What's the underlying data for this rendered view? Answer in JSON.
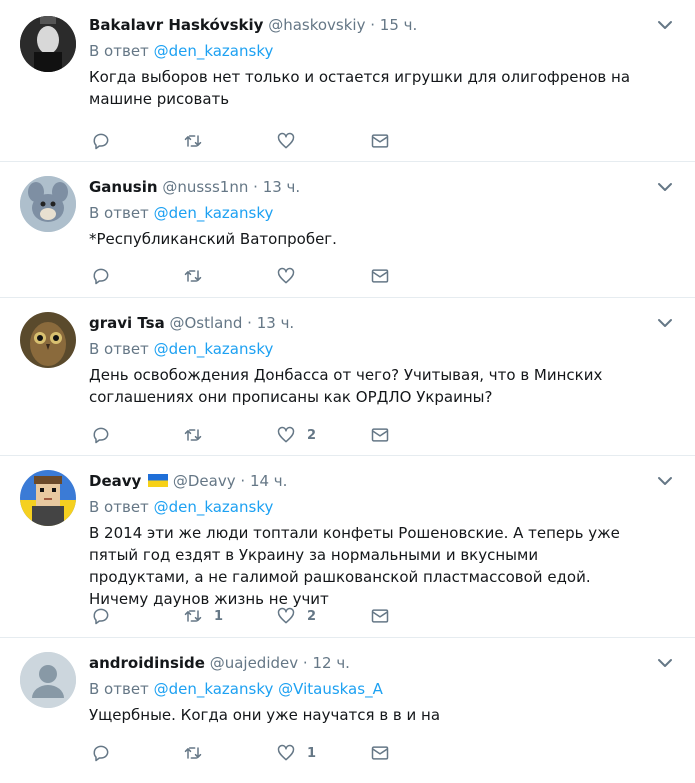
{
  "replying_prefix": "В ответ",
  "colors": {
    "link": "#1da1f2",
    "secondary": "#657786",
    "text": "#14171a",
    "border": "#e6ecf0"
  },
  "icons": {
    "reply": "reply-icon",
    "retweet": "retweet-icon",
    "like": "like-icon",
    "dm": "dm-icon",
    "caret": "chevron-down-icon"
  },
  "tweets": [
    {
      "name": "Bakalavr Haskóvskiy",
      "handle": "@haskovskiy",
      "time": "15 ч.",
      "mentions": [
        "@den_kazansky"
      ],
      "text": "Когда выборов нет только и остается игрушки для олигофренов на машине рисовать",
      "retweets": "",
      "likes": ""
    },
    {
      "name": "Ganusin",
      "handle": "@nusss1nn",
      "time": "13 ч.",
      "mentions": [
        "@den_kazansky"
      ],
      "text": "*Республиканский Ватопробег.",
      "retweets": "",
      "likes": ""
    },
    {
      "name": "gravi Tsa",
      "handle": "@Ostland",
      "time": "13 ч.",
      "mentions": [
        "@den_kazansky"
      ],
      "text": "День освобождения Донбасса от чего? Учитывая, что в Минских соглашениях они прописаны как ОРДЛО Украины?",
      "retweets": "",
      "likes": "2"
    },
    {
      "name": "Deavy",
      "handle": "@Deavy",
      "time": "14 ч.",
      "mentions": [
        "@den_kazansky"
      ],
      "text": "В 2014 эти же люди топтали конфеты Рошеновские. А теперь уже пятый год ездят в Украину за нормальными и вкусными продуктами, а не галимой рашкованской пластмассовой едой. Ничему даунов жизнь не учит",
      "retweets": "1",
      "likes": "2"
    },
    {
      "name": "androidinside",
      "handle": "@uajedidev",
      "time": "12 ч.",
      "mentions": [
        "@den_kazansky",
        "@Vitauskas_A"
      ],
      "text": "Ущербные. Когда они уже научатся в в и на",
      "retweets": "",
      "likes": "1"
    }
  ]
}
